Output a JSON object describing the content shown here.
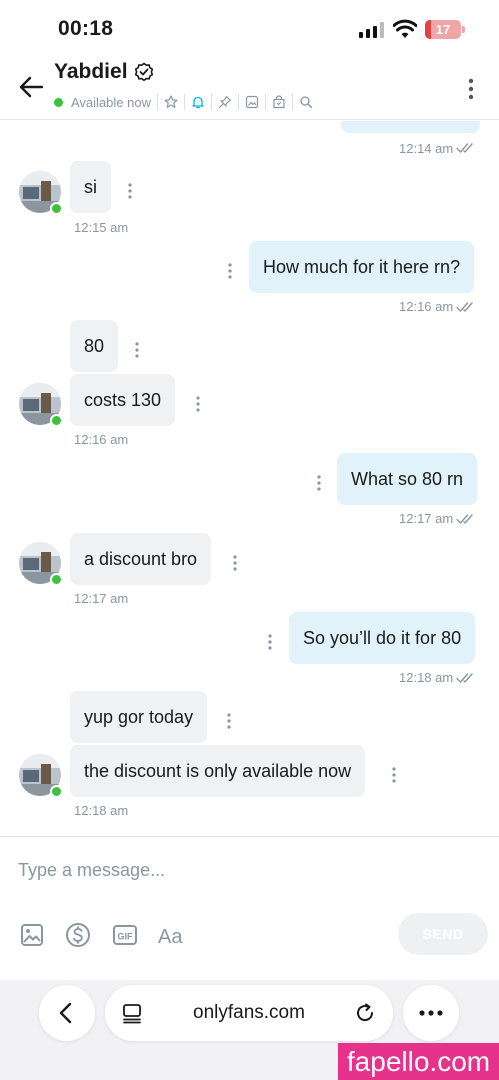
{
  "status_bar": {
    "time": "00:18",
    "battery": "17",
    "battery_level": 0.17,
    "icons": [
      "signal-icon",
      "wifi-icon",
      "battery-icon"
    ]
  },
  "header": {
    "contact_name": "Yabdiel",
    "availability": "Available now",
    "icons": [
      "back-arrow-icon",
      "verified-icon",
      "star-icon",
      "bell-icon",
      "pin-icon",
      "image-icon",
      "bag-icon",
      "search-icon",
      "more-icon"
    ],
    "accent_color": "#00aff0",
    "online_color": "#3cc13b"
  },
  "messages": [
    {
      "id": "m1",
      "sender": "me",
      "timestamp": "12:14 am",
      "read": true
    },
    {
      "id": "m2",
      "sender": "them",
      "text": "si",
      "timestamp": "12:15 am"
    },
    {
      "id": "m3",
      "sender": "me",
      "text": "How much for it here rn?",
      "timestamp": "12:16 am",
      "read": true
    },
    {
      "id": "m4",
      "sender": "them",
      "text": "80"
    },
    {
      "id": "m5",
      "sender": "them",
      "text": "costs 130",
      "timestamp": "12:16 am"
    },
    {
      "id": "m6",
      "sender": "me",
      "text": "What so 80 rn",
      "timestamp": "12:17 am",
      "read": true
    },
    {
      "id": "m7",
      "sender": "them",
      "text": "a discount bro",
      "timestamp": "12:17 am"
    },
    {
      "id": "m8",
      "sender": "me",
      "text": "So you’ll do it for 80",
      "timestamp": "12:18 am",
      "read": true
    },
    {
      "id": "m9",
      "sender": "them",
      "text": "yup gor today"
    },
    {
      "id": "m10",
      "sender": "them",
      "text": "the discount is only available now",
      "timestamp": "12:18 am"
    }
  ],
  "composer": {
    "placeholder": "Type a message...",
    "send_label": "SEND",
    "tools": [
      "image-icon",
      "dollar-icon",
      "gif-icon",
      "text-format-icon"
    ]
  },
  "browser": {
    "url": "onlyfans.com",
    "icons": [
      "back-icon",
      "tabs-icon",
      "reload-icon",
      "more-icon"
    ]
  },
  "watermark": "fapello.com",
  "colors": {
    "incoming_bubble": "#f0f1f3",
    "outgoing_bubble": "#e2f2fb",
    "timestamp": "#8a96a3",
    "watermark_bg": "#e6328a"
  }
}
